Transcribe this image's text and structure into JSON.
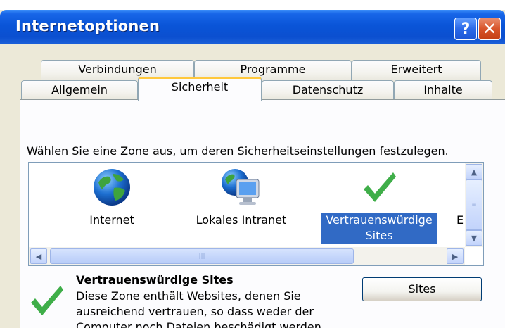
{
  "window": {
    "title": "Internetoptionen"
  },
  "title_buttons": {
    "help": "?",
    "close": "✕"
  },
  "tabs_row1": [
    "Verbindungen",
    "Programme",
    "Erweitert"
  ],
  "tabs_row2": [
    "Allgemein",
    "Sicherheit",
    "Datenschutz",
    "Inhalte"
  ],
  "active_tab": "Sicherheit",
  "instruction": "Wählen Sie eine Zone aus, um deren Sicherheitseinstellungen festzulegen.",
  "zones": [
    {
      "label": "Internet",
      "icon": "globe-icon",
      "selected": false
    },
    {
      "label": "Lokales Intranet",
      "icon": "computer-globe-icon",
      "selected": false
    },
    {
      "label_line1": "Vertrauenswürdige",
      "label_line2": "Sites",
      "icon": "checkmark-icon",
      "selected": true
    },
    {
      "label": "E",
      "icon": "restricted-icon",
      "selected": false
    }
  ],
  "details": {
    "title": "Vertrauenswürdige Sites",
    "description": "Diese Zone enthält Websites, denen Sie ausreichend vertrauen, so dass weder der Computer noch Dateien beschädigt werden.",
    "icon": "checkmark-icon"
  },
  "sites_button": {
    "label": "Sites"
  },
  "colors": {
    "titlebar": "#0b4fd0",
    "selection": "#316ac5",
    "active_tab_accent": "#ffc83c",
    "checkmark": "#3fae49"
  }
}
